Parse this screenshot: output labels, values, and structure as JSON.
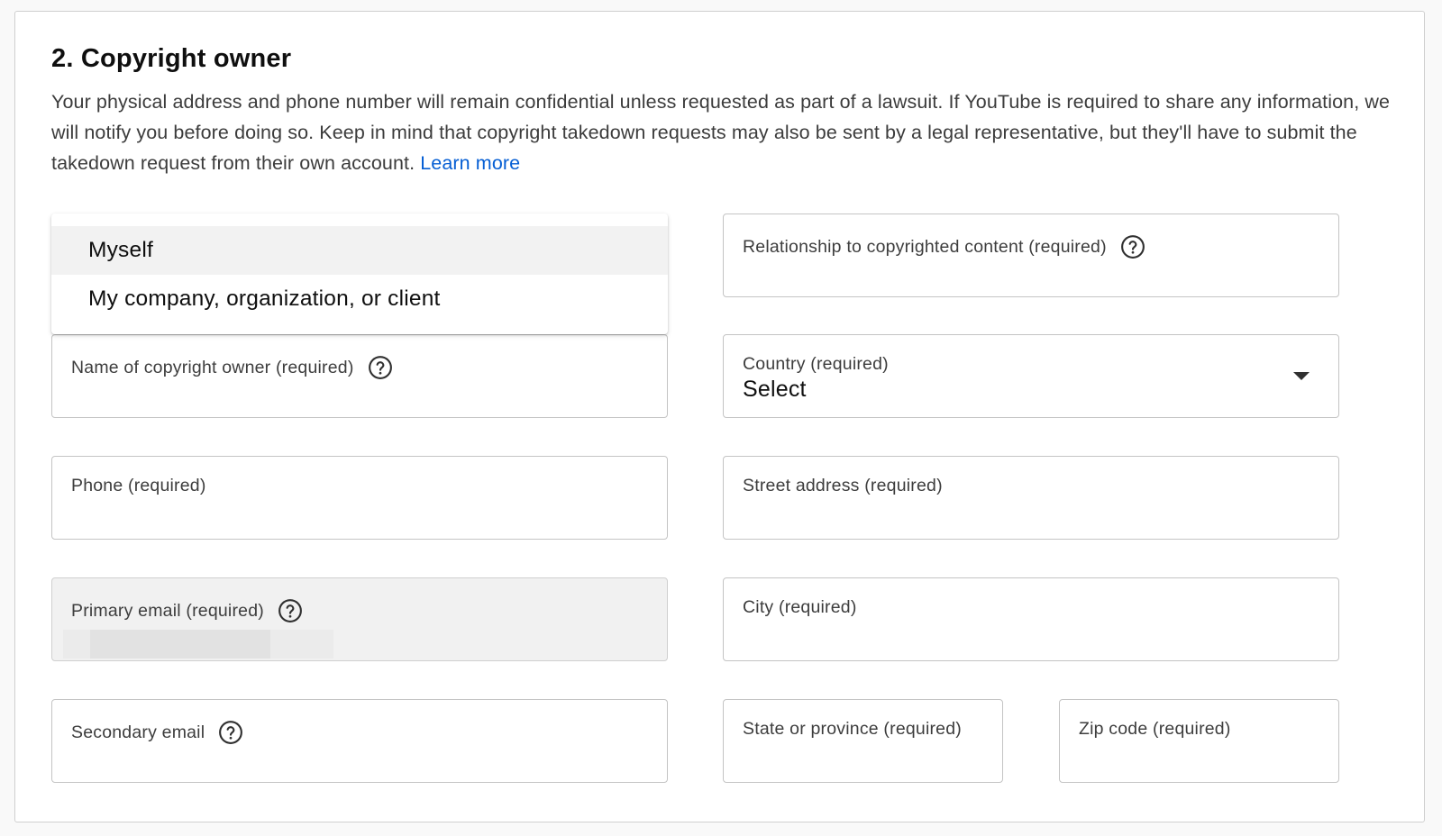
{
  "section": {
    "title": "2. Copyright owner",
    "description": "Your physical address and phone number will remain confidential unless requested as part of a lawsuit. If YouTube is required to share any information, we will notify you before doing so. Keep in mind that copyright takedown requests may also be sent by a legal representative, but they'll have to submit the takedown request from their own account.",
    "learn_more": "Learn more"
  },
  "owner_menu": {
    "options": [
      "Myself",
      "My company, organization, or client"
    ],
    "highlighted": "Myself"
  },
  "fields": {
    "owner_name": {
      "label": "Name of copyright owner (required)"
    },
    "phone": {
      "label": "Phone (required)"
    },
    "primary_email": {
      "label": "Primary email (required)"
    },
    "secondary_email": {
      "label": "Secondary email"
    },
    "relationship": {
      "label": "Relationship to copyrighted content (required)"
    },
    "country": {
      "label": "Country (required)",
      "value": "Select"
    },
    "street": {
      "label": "Street address (required)"
    },
    "city": {
      "label": "City (required)"
    },
    "state": {
      "label": "State or province (required)"
    },
    "zip": {
      "label": "Zip code (required)"
    }
  },
  "colors": {
    "link": "#065fd4",
    "border": "#c4c4c4",
    "disabled_bg": "#f1f1f1",
    "menu_highlight": "#f2f2f2"
  },
  "icons": {
    "help": "help-circle-icon",
    "dropdown": "caret-down-icon"
  }
}
